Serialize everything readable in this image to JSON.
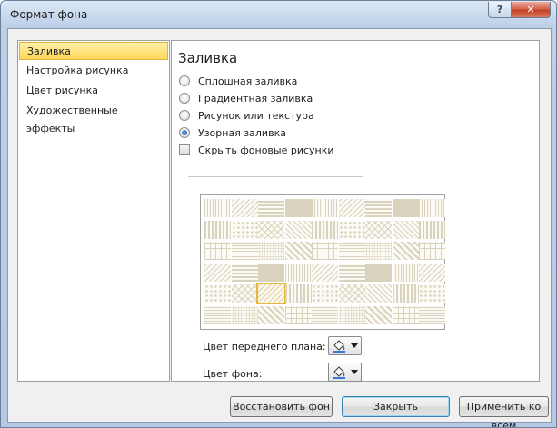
{
  "window": {
    "title": "Формат фона",
    "help_glyph": "?",
    "close_glyph": "✕"
  },
  "nav": {
    "items": [
      {
        "label": "Заливка",
        "active": true
      },
      {
        "label": "Настройка рисунка",
        "active": false
      },
      {
        "label": "Цвет рисунка",
        "active": false
      },
      {
        "label": "Художественные эффекты",
        "active": false
      }
    ]
  },
  "panel": {
    "title": "Заливка",
    "options": [
      {
        "label": "Сплошная заливка",
        "checked": false
      },
      {
        "label": "Градиентная заливка",
        "checked": false
      },
      {
        "label": "Рисунок или текстура",
        "checked": false
      },
      {
        "label": "Узорная заливка",
        "checked": true
      }
    ],
    "hide_bg": {
      "label": "Скрыть фоновые рисунки",
      "checked": false
    },
    "pattern": {
      "rows": 6,
      "cols": 9,
      "selected_row": 4,
      "selected_col": 2
    },
    "fg_label": "Цвет переднего плана:",
    "bg_label": "Цвет фона:"
  },
  "footer": {
    "reset": "Восстановить фон",
    "close": "Закрыть",
    "apply_all": "Применить ко всем"
  },
  "colors": {
    "active_nav": "#ffd75a",
    "pattern_fg": "#d9d2bc",
    "pattern_selected": "#e8b63c"
  },
  "icons": {
    "paint_bucket": "paint-bucket-icon",
    "dropdown": "chevron-down-icon"
  }
}
